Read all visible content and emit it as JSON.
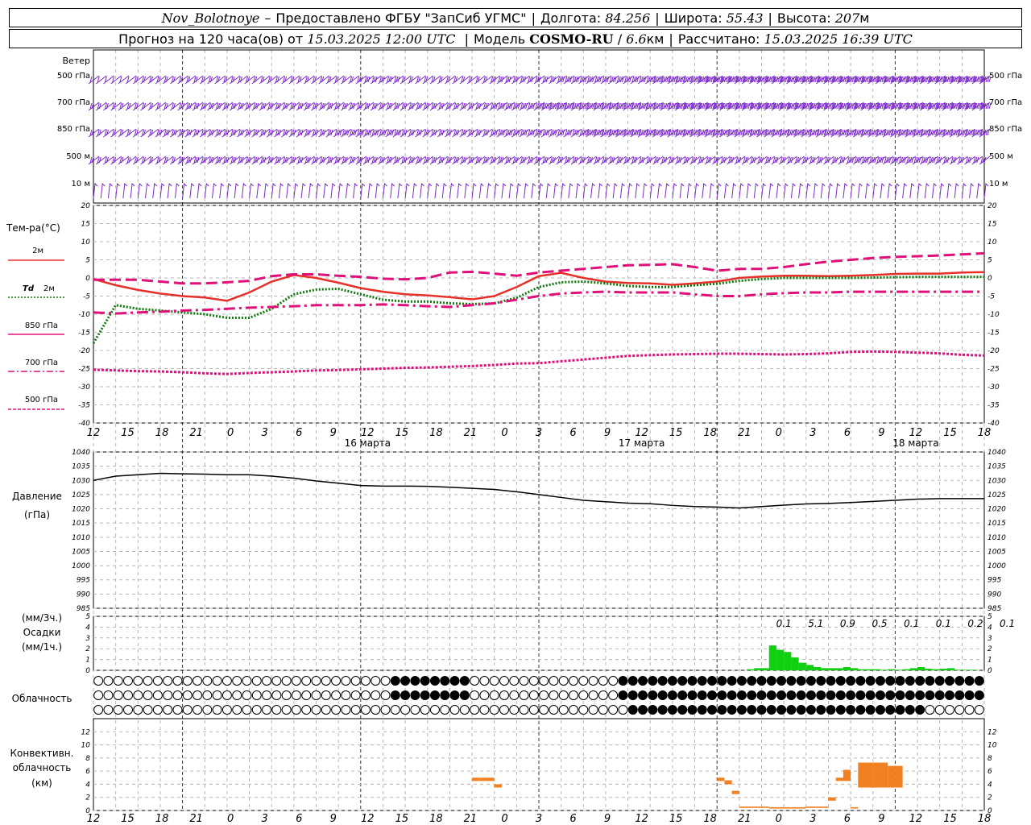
{
  "header": {
    "station": "Nov_Bolotnoye",
    "provider": "Предоставлено ФГБУ \"ЗапСиб УГМС\"",
    "lon_label": "Долгота:",
    "lon_value": "84.256",
    "lat_label": "Широта:",
    "lat_value": "55.43",
    "alt_label": "Высота:",
    "alt_value": "207",
    "alt_unit": "м",
    "forecast_prefix": "Прогноз на 120 часа(ов) от",
    "forecast_start": "15.03.2025 12:00 UTC",
    "model_label": "Модель",
    "model_name": "COSMO-RU",
    "model_res": "6.6",
    "model_res_unit": "км",
    "calc_label": "Рассчитано:",
    "calc_time": "15.03.2025 16:39 UTC"
  },
  "colors": {
    "wind": "#7a28c8",
    "t2m": "#e8302a",
    "td2m": "#0b7a0b",
    "t850": "#e0107a",
    "t700": "#e0107a",
    "t500": "#e0107a",
    "pressure": "#000000",
    "precip": "#10d010",
    "convective": "#f08020",
    "grid": "#b8b8b8"
  },
  "labels": {
    "wind_title": "Ветер",
    "wind_levels": [
      "500 гПа",
      "700 гПа",
      "850 гПа",
      "500 м",
      "10 м"
    ],
    "temp_title": "Тем-ра(°C)",
    "legend_2m": "2м",
    "legend_td": "Td",
    "legend_td_2m": "2м",
    "legend_850": "850 гПа",
    "legend_700": "700 гПа",
    "legend_500": "500 гПа",
    "pressure_title": "Давление",
    "pressure_unit": "(гПа)",
    "precip_unit_3h": "(мм/3ч.)",
    "precip_title": "Осадки",
    "precip_unit_1h": "(мм/1ч.)",
    "cloud_title": "Облачность",
    "conv_title_1": "Конвективн.",
    "conv_title_2": "облачность",
    "conv_unit": "(км)"
  },
  "time_axis": {
    "hour_labels": [
      "12",
      "15",
      "18",
      "21",
      "0",
      "3",
      "6",
      "9",
      "12",
      "15",
      "18",
      "21",
      "0",
      "3",
      "6",
      "9",
      "12",
      "15",
      "18",
      "21",
      "0",
      "3",
      "6",
      "9",
      "12",
      "15",
      "18"
    ],
    "date_labels": [
      "16 марта",
      "17 марта",
      "18 марта"
    ]
  },
  "chart_data": [
    {
      "type": "line",
      "title": "Тем-ра(°C)",
      "x_hours_from_start": [
        0,
        3,
        6,
        9,
        12,
        15,
        18,
        21,
        24,
        27,
        30,
        33,
        36,
        39,
        42,
        45,
        48,
        51,
        54,
        57,
        60,
        63,
        66,
        69,
        72,
        75,
        78,
        81,
        84,
        87,
        90,
        93,
        96,
        99,
        102,
        105,
        108,
        111,
        114,
        117,
        120
      ],
      "ylim": [
        -40,
        20
      ],
      "y_ticks": [
        20,
        15,
        10,
        5,
        0,
        -5,
        -10,
        -15,
        -20,
        -25,
        -30,
        -35,
        -40
      ],
      "series": [
        {
          "name": "2м",
          "values": [
            -0.3,
            -2,
            -3.3,
            -4.3,
            -5,
            -5.4,
            -6.3,
            -4,
            -1,
            0.8,
            0,
            -1.3,
            -2.8,
            -3.8,
            -4.5,
            -4.8,
            -5.3,
            -5.9,
            -5,
            -2.5,
            0.5,
            1.4,
            0,
            -1,
            -1.4,
            -1.5,
            -1.9,
            -1.5,
            -1,
            0,
            0.4,
            0.6,
            0.6,
            0.5,
            0.6,
            0.8,
            1.1,
            1.2,
            1.2,
            1.5,
            1.6
          ]
        },
        {
          "name": "Td 2м",
          "values": [
            -18,
            -7.5,
            -8.5,
            -9,
            -9.5,
            -10,
            -11,
            -11,
            -8.5,
            -4.5,
            -3.2,
            -3,
            -4.5,
            -6,
            -6.5,
            -6.5,
            -7,
            -7.2,
            -7,
            -5.5,
            -2.5,
            -1.2,
            -1,
            -1.5,
            -2.2,
            -2.5,
            -2.5,
            -2,
            -1.6,
            -0.8,
            -0.3,
            0,
            0,
            0,
            0,
            0.1,
            0.2,
            0.3,
            0.3,
            0.3,
            0.3
          ]
        },
        {
          "name": "850 гПа",
          "values": [
            -0.5,
            -0.5,
            -0.5,
            -1,
            -1.5,
            -1.5,
            -1.2,
            -0.8,
            0.5,
            1,
            1,
            0.6,
            0.3,
            -0.2,
            -0.4,
            0,
            1.5,
            1.7,
            1.2,
            0.6,
            1.5,
            2,
            2.5,
            3,
            3.5,
            3.6,
            3.8,
            3,
            2,
            2.5,
            2.5,
            3,
            3.8,
            4.5,
            5,
            5.5,
            5.8,
            6,
            6.2,
            6.5,
            6.8
          ]
        },
        {
          "name": "700 гПа",
          "values": [
            -9.5,
            -9.8,
            -9.5,
            -9.3,
            -9,
            -8.8,
            -8.5,
            -8.2,
            -8,
            -7.8,
            -7.5,
            -7.5,
            -7.5,
            -7.3,
            -7.5,
            -7.8,
            -8,
            -7.5,
            -7,
            -6,
            -5,
            -4.3,
            -4,
            -3.8,
            -4,
            -4,
            -4,
            -4.5,
            -5,
            -5,
            -4.5,
            -4.2,
            -4,
            -4,
            -3.8,
            -3.8,
            -3.8,
            -3.8,
            -3.8,
            -3.8,
            -3.8
          ]
        },
        {
          "name": "500 гПа",
          "values": [
            -25.3,
            -25.5,
            -25.7,
            -25.8,
            -26,
            -26.3,
            -26.5,
            -26.2,
            -26,
            -25.8,
            -25.5,
            -25.4,
            -25.2,
            -25,
            -24.8,
            -24.7,
            -24.5,
            -24.3,
            -24,
            -23.6,
            -23.5,
            -23,
            -22.5,
            -22,
            -21.5,
            -21.3,
            -21.1,
            -21,
            -20.9,
            -20.9,
            -21,
            -21.1,
            -21,
            -20.8,
            -20.4,
            -20.3,
            -20.4,
            -20.6,
            -20.8,
            -21.2,
            -21.4
          ]
        }
      ]
    },
    {
      "type": "line",
      "title": "Давление",
      "ylabel": "(гПа)",
      "ylim": [
        985,
        1040
      ],
      "y_ticks": [
        1040,
        1035,
        1030,
        1025,
        1020,
        1015,
        1010,
        1005,
        1000,
        995,
        990,
        985
      ],
      "x_hours_from_start": [
        0,
        3,
        6,
        9,
        12,
        15,
        18,
        21,
        24,
        27,
        30,
        33,
        36,
        39,
        42,
        45,
        48,
        51,
        54,
        57,
        60,
        63,
        66,
        69,
        72,
        75,
        78,
        81,
        84,
        87,
        90,
        93,
        96,
        99,
        102,
        105,
        108,
        111,
        114,
        117,
        120
      ],
      "values": [
        1030,
        1031.5,
        1032,
        1032.5,
        1032.3,
        1032.2,
        1032,
        1032,
        1031.5,
        1030.8,
        1029.8,
        1029,
        1028.2,
        1028,
        1028,
        1027.9,
        1027.6,
        1027.2,
        1026.8,
        1026,
        1025,
        1024,
        1023,
        1022.5,
        1022,
        1021.8,
        1021.2,
        1020.8,
        1020.6,
        1020.3,
        1020.8,
        1021.3,
        1021.7,
        1021.9,
        1022.2,
        1022.6,
        1023,
        1023.4,
        1023.6,
        1023.6,
        1023.6
      ]
    },
    {
      "type": "bar",
      "title": "Осадки",
      "ylabel": "(мм/3ч.) (мм/1ч.)",
      "ylim": [
        0,
        5
      ],
      "y_ticks": [
        5,
        4,
        3,
        2,
        1,
        0
      ],
      "totals_3h": [
        "0.1",
        "5.1",
        "0.9",
        "0.5",
        "0.1",
        "0.1",
        "0.2",
        "0.1"
      ],
      "hourly_x_hours_from_start": [
        88,
        89,
        90,
        91,
        92,
        93,
        94,
        95,
        96,
        97,
        98,
        99,
        100,
        101,
        102,
        103,
        104,
        105,
        106,
        107,
        108,
        109,
        110,
        111,
        112,
        113,
        114,
        115,
        116,
        117,
        118
      ],
      "hourly_values": [
        0.1,
        0.2,
        0.2,
        2.3,
        1.9,
        1.7,
        1.2,
        0.7,
        0.5,
        0.3,
        0.2,
        0.2,
        0.2,
        0.3,
        0.2,
        0.1,
        0.1,
        0.1,
        0.05,
        0.1,
        0.05,
        0.1,
        0.2,
        0.3,
        0.15,
        0.1,
        0.15,
        0.2,
        0.05,
        0.05,
        0.05
      ]
    },
    {
      "type": "table",
      "title": "Облачность",
      "rows": 3,
      "columns": 90,
      "cloud_fraction_rows": [
        "0000000000000000000000000000000000000000000000000001111111111111000000000000000000000000011111111111111111111111111111111111111111111111111111111111111111",
        "0000000000000000000000000000000000000000000000000001111111111111000000000000000000000000011111111111111111111111111111111111111111111111111111111111111111",
        "0000000000000000000000000000000000000000000000000000000000000000000000000000000000000000000011111111111111111111111111111111111111111111111111100000000000"
      ]
    },
    {
      "type": "bar",
      "title": "Конвективн. облачность",
      "ylabel": "(км)",
      "ylim": [
        0,
        14
      ],
      "y_ticks": [
        12,
        10,
        8,
        6,
        4,
        2,
        0
      ],
      "bars": [
        {
          "x_hours": 51,
          "bottom": 4.5,
          "top": 5.0
        },
        {
          "x_hours": 52,
          "bottom": 4.5,
          "top": 5.0
        },
        {
          "x_hours": 53,
          "bottom": 4.5,
          "top": 5.0
        },
        {
          "x_hours": 54,
          "bottom": 3.5,
          "top": 4.0
        },
        {
          "x_hours": 84,
          "bottom": 4.5,
          "top": 5.0
        },
        {
          "x_hours": 85,
          "bottom": 4.0,
          "top": 4.6
        },
        {
          "x_hours": 86,
          "bottom": 2.5,
          "top": 3.0
        },
        {
          "x_hours": 87,
          "bottom": 0.4,
          "top": 0.6
        },
        {
          "x_hours": 88,
          "bottom": 0.4,
          "top": 0.6
        },
        {
          "x_hours": 89,
          "bottom": 0.4,
          "top": 0.6
        },
        {
          "x_hours": 90,
          "bottom": 0.4,
          "top": 0.6
        },
        {
          "x_hours": 91,
          "bottom": 0.3,
          "top": 0.5
        },
        {
          "x_hours": 92,
          "bottom": 0.3,
          "top": 0.5
        },
        {
          "x_hours": 93,
          "bottom": 0.3,
          "top": 0.5
        },
        {
          "x_hours": 94,
          "bottom": 0.3,
          "top": 0.5
        },
        {
          "x_hours": 95,
          "bottom": 0.3,
          "top": 0.5
        },
        {
          "x_hours": 96,
          "bottom": 0.4,
          "top": 0.6
        },
        {
          "x_hours": 97,
          "bottom": 0.4,
          "top": 0.6
        },
        {
          "x_hours": 98,
          "bottom": 0.4,
          "top": 0.6
        },
        {
          "x_hours": 99,
          "bottom": 1.5,
          "top": 2.0
        },
        {
          "x_hours": 100,
          "bottom": 4.5,
          "top": 5.0
        },
        {
          "x_hours": 101,
          "bottom": 4.5,
          "top": 6.2
        },
        {
          "x_hours": 102,
          "bottom": 0.3,
          "top": 0.5
        },
        {
          "x_hours": 103,
          "bottom": 3.5,
          "top": 7.3
        },
        {
          "x_hours": 104,
          "bottom": 3.5,
          "top": 7.3
        },
        {
          "x_hours": 105,
          "bottom": 3.5,
          "top": 7.3
        },
        {
          "x_hours": 106,
          "bottom": 3.5,
          "top": 7.3
        },
        {
          "x_hours": 107,
          "bottom": 3.5,
          "top": 6.8
        },
        {
          "x_hours": 108,
          "bottom": 3.5,
          "top": 6.8
        }
      ]
    },
    {
      "type": "scatter",
      "title": "Ветер",
      "levels": [
        "500 гПа",
        "700 гПа",
        "850 гПа",
        "500 м",
        "10 м"
      ],
      "note": "wind barbs at each hour; speeds in knots-style barb notation",
      "barb_speed_by_level": [
        [
          10,
          12,
          15,
          18,
          20,
          22,
          22,
          20,
          18,
          18,
          20,
          22,
          25,
          25,
          22,
          20,
          20,
          22,
          25,
          28,
          32,
          35,
          38,
          40,
          42,
          45,
          50,
          55,
          55,
          55,
          55,
          55,
          55,
          55,
          55,
          55,
          55,
          55,
          55,
          55,
          55
        ],
        [
          15,
          18,
          20,
          22,
          25,
          25,
          25,
          25,
          25,
          25,
          28,
          30,
          30,
          30,
          30,
          30,
          30,
          32,
          35,
          40,
          45,
          50,
          50,
          50,
          50,
          50,
          55,
          55,
          55,
          55,
          55,
          55,
          55,
          55,
          55,
          55,
          55,
          55,
          55,
          55,
          55
        ],
        [
          15,
          18,
          22,
          25,
          28,
          30,
          30,
          28,
          28,
          30,
          32,
          35,
          35,
          35,
          32,
          30,
          30,
          32,
          35,
          38,
          40,
          42,
          45,
          45,
          45,
          45,
          45,
          45,
          45,
          45,
          45,
          45,
          45,
          45,
          45,
          45,
          45,
          45,
          45,
          45,
          45
        ],
        [
          15,
          18,
          20,
          22,
          25,
          25,
          25,
          25,
          25,
          25,
          25,
          25,
          25,
          25,
          25,
          25,
          25,
          25,
          25,
          28,
          30,
          30,
          30,
          30,
          30,
          30,
          30,
          30,
          30,
          30,
          30,
          30,
          30,
          30,
          35,
          40,
          40,
          35,
          30,
          30,
          30
        ],
        [
          5,
          5,
          5,
          5,
          5,
          5,
          5,
          5,
          5,
          5,
          5,
          5,
          5,
          5,
          5,
          5,
          5,
          5,
          5,
          5,
          5,
          5,
          5,
          5,
          5,
          5,
          5,
          5,
          5,
          5,
          5,
          5,
          5,
          5,
          5,
          5,
          5,
          5,
          5,
          5,
          5
        ]
      ]
    }
  ]
}
